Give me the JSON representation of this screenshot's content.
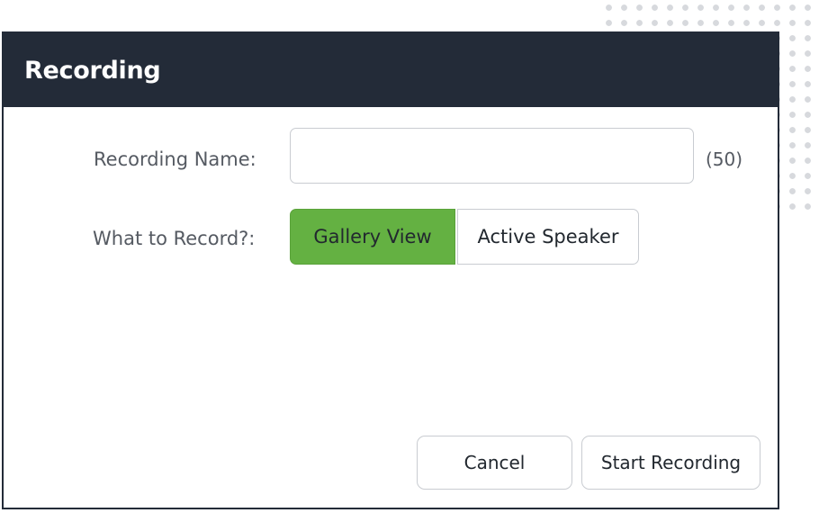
{
  "dialog": {
    "title": "Recording",
    "name_label": "Recording Name:",
    "name_value": "",
    "name_counter": "(50)",
    "record_label": "What to Record?:",
    "record_options": [
      "Gallery View",
      "Active Speaker"
    ],
    "record_selected": "Gallery View",
    "cancel_label": "Cancel",
    "start_label": "Start Recording"
  },
  "colors": {
    "header_bg": "#232b38",
    "selected_option": "#64b142"
  }
}
